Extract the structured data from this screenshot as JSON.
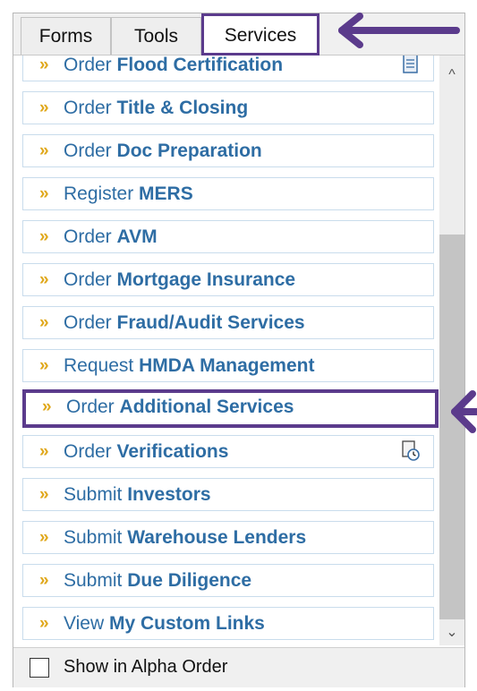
{
  "tabs": [
    {
      "label": "Forms"
    },
    {
      "label": "Tools"
    },
    {
      "label": "Services"
    }
  ],
  "items": [
    {
      "verb": "Order",
      "noun": "Flood Certification",
      "icon": "document-icon"
    },
    {
      "verb": "Order",
      "noun": "Title & Closing"
    },
    {
      "verb": "Order",
      "noun": "Doc Preparation"
    },
    {
      "verb": "Register",
      "noun": "MERS"
    },
    {
      "verb": "Order",
      "noun": "AVM"
    },
    {
      "verb": "Order",
      "noun": "Mortgage Insurance"
    },
    {
      "verb": "Order",
      "noun": "Fraud/Audit Services"
    },
    {
      "verb": "Request",
      "noun": "HMDA Management"
    },
    {
      "verb": "Order",
      "noun": "Additional Services",
      "highlighted": true
    },
    {
      "verb": "Order",
      "noun": "Verifications",
      "icon": "clock-document-icon"
    },
    {
      "verb": "Submit",
      "noun": "Investors"
    },
    {
      "verb": "Submit",
      "noun": "Warehouse Lenders"
    },
    {
      "verb": "Submit",
      "noun": "Due Diligence"
    },
    {
      "verb": "View",
      "noun": "My Custom Links"
    }
  ],
  "footer": {
    "checkbox_label": "Show in Alpha Order",
    "checked": false
  },
  "colors": {
    "accent": "#5b3b8c",
    "link": "#2e6da4",
    "chevron": "#e0a81c"
  },
  "icons": {
    "chevron": "»",
    "scroll_up": "scroll-up-icon",
    "scroll_down": "scroll-down-icon",
    "annotation": "arrow-left-icon"
  }
}
